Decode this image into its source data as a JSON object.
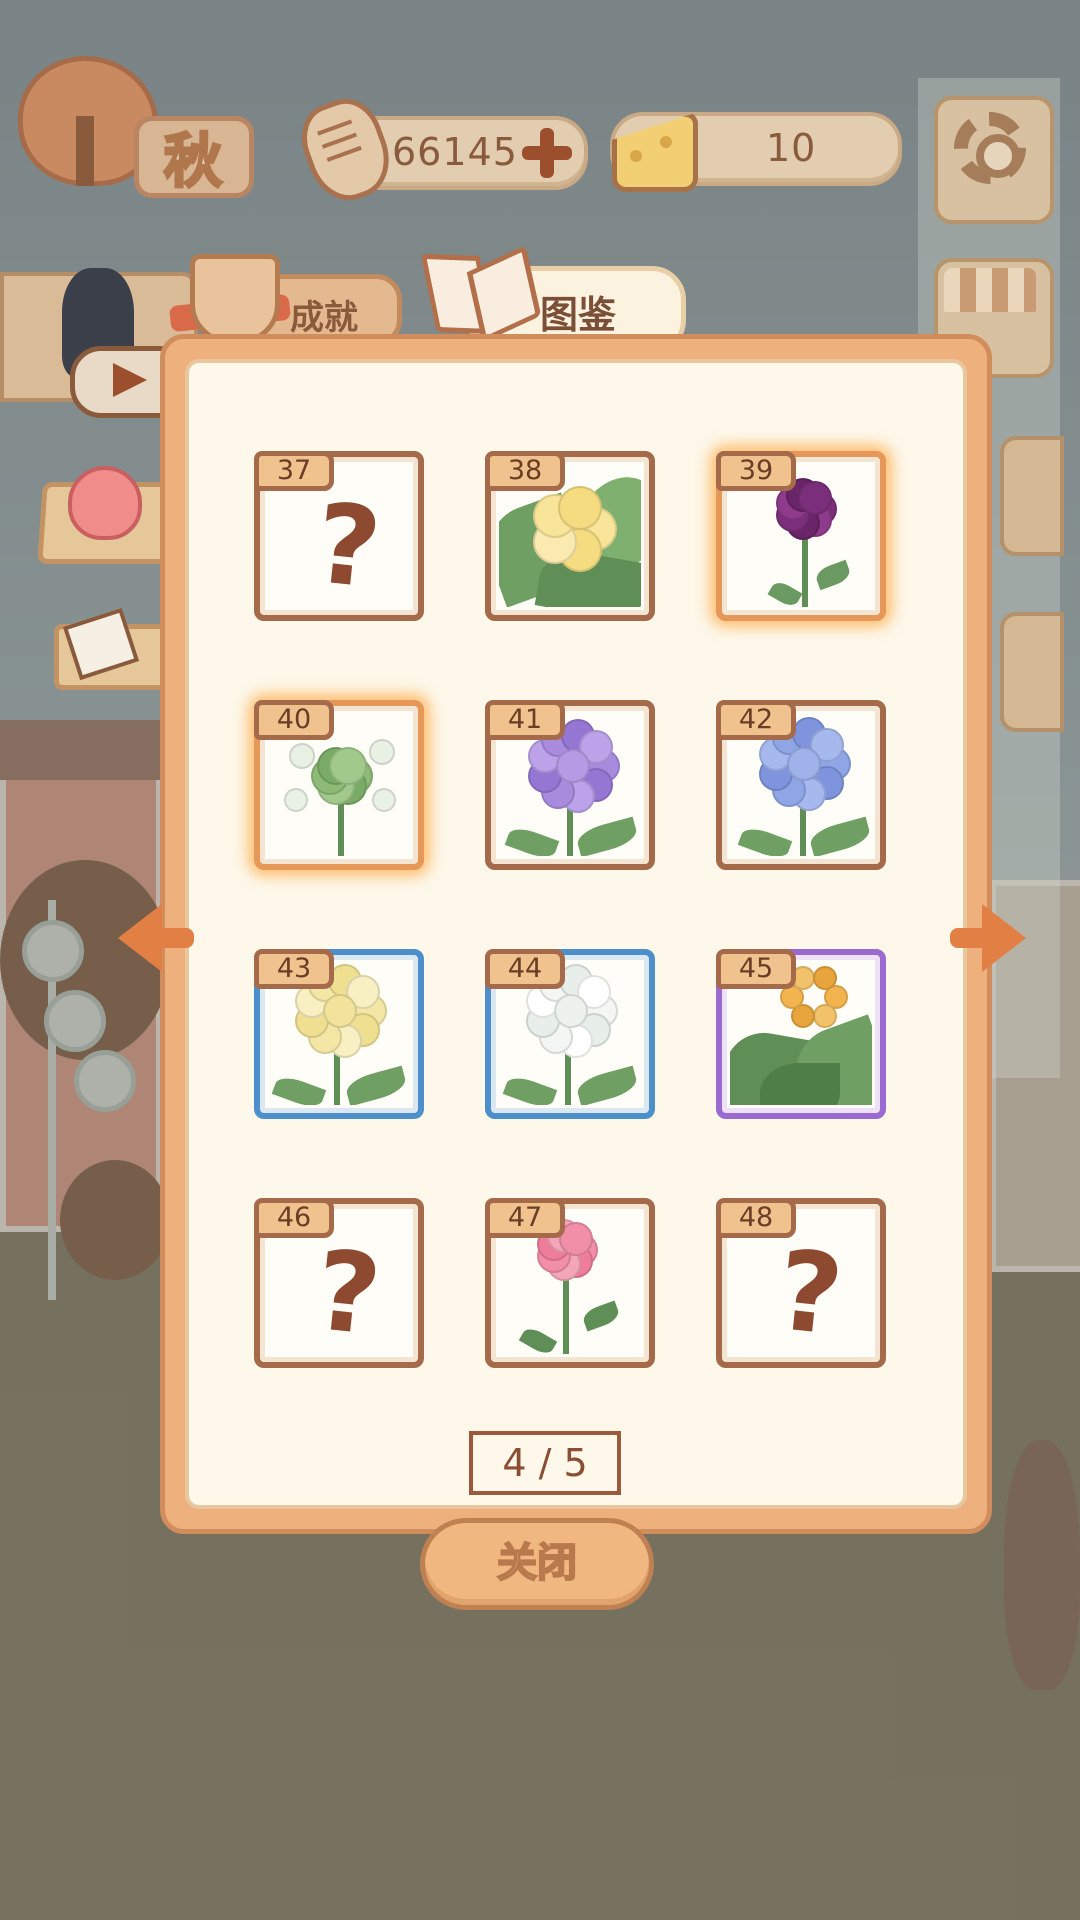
{
  "hud": {
    "season_label": "秋",
    "fish_bones": "66145",
    "cheese": "10"
  },
  "tabs": {
    "achievements": "成就",
    "atlas": "图鉴"
  },
  "collection": {
    "slots": [
      {
        "number": "37",
        "unlocked": false,
        "flower": "unknown"
      },
      {
        "number": "38",
        "unlocked": true,
        "flower": "plumeria"
      },
      {
        "number": "39",
        "unlocked": true,
        "flower": "purple-rose"
      },
      {
        "number": "40",
        "unlocked": true,
        "flower": "green-protea"
      },
      {
        "number": "41",
        "unlocked": true,
        "flower": "purple-hydrangea"
      },
      {
        "number": "42",
        "unlocked": true,
        "flower": "blue-hydrangea"
      },
      {
        "number": "43",
        "unlocked": true,
        "flower": "yellow-hydrangea"
      },
      {
        "number": "44",
        "unlocked": true,
        "flower": "white-hydrangea"
      },
      {
        "number": "45",
        "unlocked": true,
        "flower": "bird-of-paradise"
      },
      {
        "number": "46",
        "unlocked": false,
        "flower": "unknown"
      },
      {
        "number": "47",
        "unlocked": true,
        "flower": "pink-rose"
      },
      {
        "number": "48",
        "unlocked": false,
        "flower": "unknown"
      }
    ],
    "locked_symbol": "?",
    "page_indicator": "4 / 5"
  },
  "buttons": {
    "close": "关闭"
  },
  "colors": {
    "panel_frame": "#eeb07d",
    "panel_inner": "#fdf8ea",
    "common_border": "#a46a4a",
    "rare_blue": "#4d8fcb",
    "epic_purple": "#9a6ad0",
    "arrow": "#e17f44"
  }
}
